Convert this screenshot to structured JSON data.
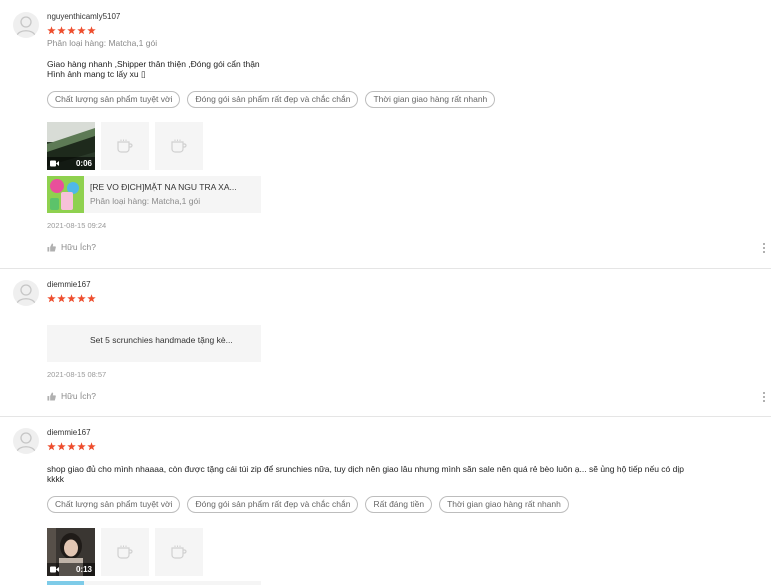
{
  "colors": {
    "star": "#ee4d2d",
    "tag_border": "#bdbdbd",
    "divider": "#e5e5e5"
  },
  "reviews": [
    {
      "username": "nguyenthicamly5107",
      "rating": 5,
      "variation": "Phân loại hàng: Matcha,1 gói",
      "content_lines": [
        "Giao hàng nhanh ,Shipper thân thiện ,Đóng gói cẩn thận",
        "Hình ảnh mang tc lấy xu ▯"
      ],
      "tags": [
        "Chất lượng sản phẩm tuyệt vời",
        "Đóng gói sản phẩm rất đẹp và chắc chắn",
        "Thời gian giao hàng rất nhanh"
      ],
      "video_duration": "0:06",
      "product": {
        "name": "[RE VO ĐỊCH]MẶT NA NGU TRA XA...",
        "variation": "Phân loại hàng: Matcha,1 gói"
      },
      "time": "2021-08-15 09:24",
      "helpful": "Hữu Ích?"
    },
    {
      "username": "diemmie167",
      "rating": 5,
      "product": {
        "name": "Set 5 scrunchies handmade tặng kè..."
      },
      "time": "2021-08-15 08:57",
      "helpful": "Hữu Ích?"
    },
    {
      "username": "diemmie167",
      "rating": 5,
      "content_lines": [
        "shop giao đủ cho mình nhaaaa, còn được tặng cái túi zip để srunchies nữa, tuy dịch nên giao lâu nhưng mình săn sale nên quá rẻ bèo luôn ạ... sẽ ủng hộ tiếp nếu có dịp",
        "kkkk"
      ],
      "tags": [
        "Chất lượng sản phẩm tuyệt vời",
        "Đóng gói sản phẩm rất đẹp và chắc chắn",
        "Rất đáng tiền",
        "Thời gian giao hàng rất nhanh"
      ],
      "video_duration": "0:13"
    }
  ]
}
